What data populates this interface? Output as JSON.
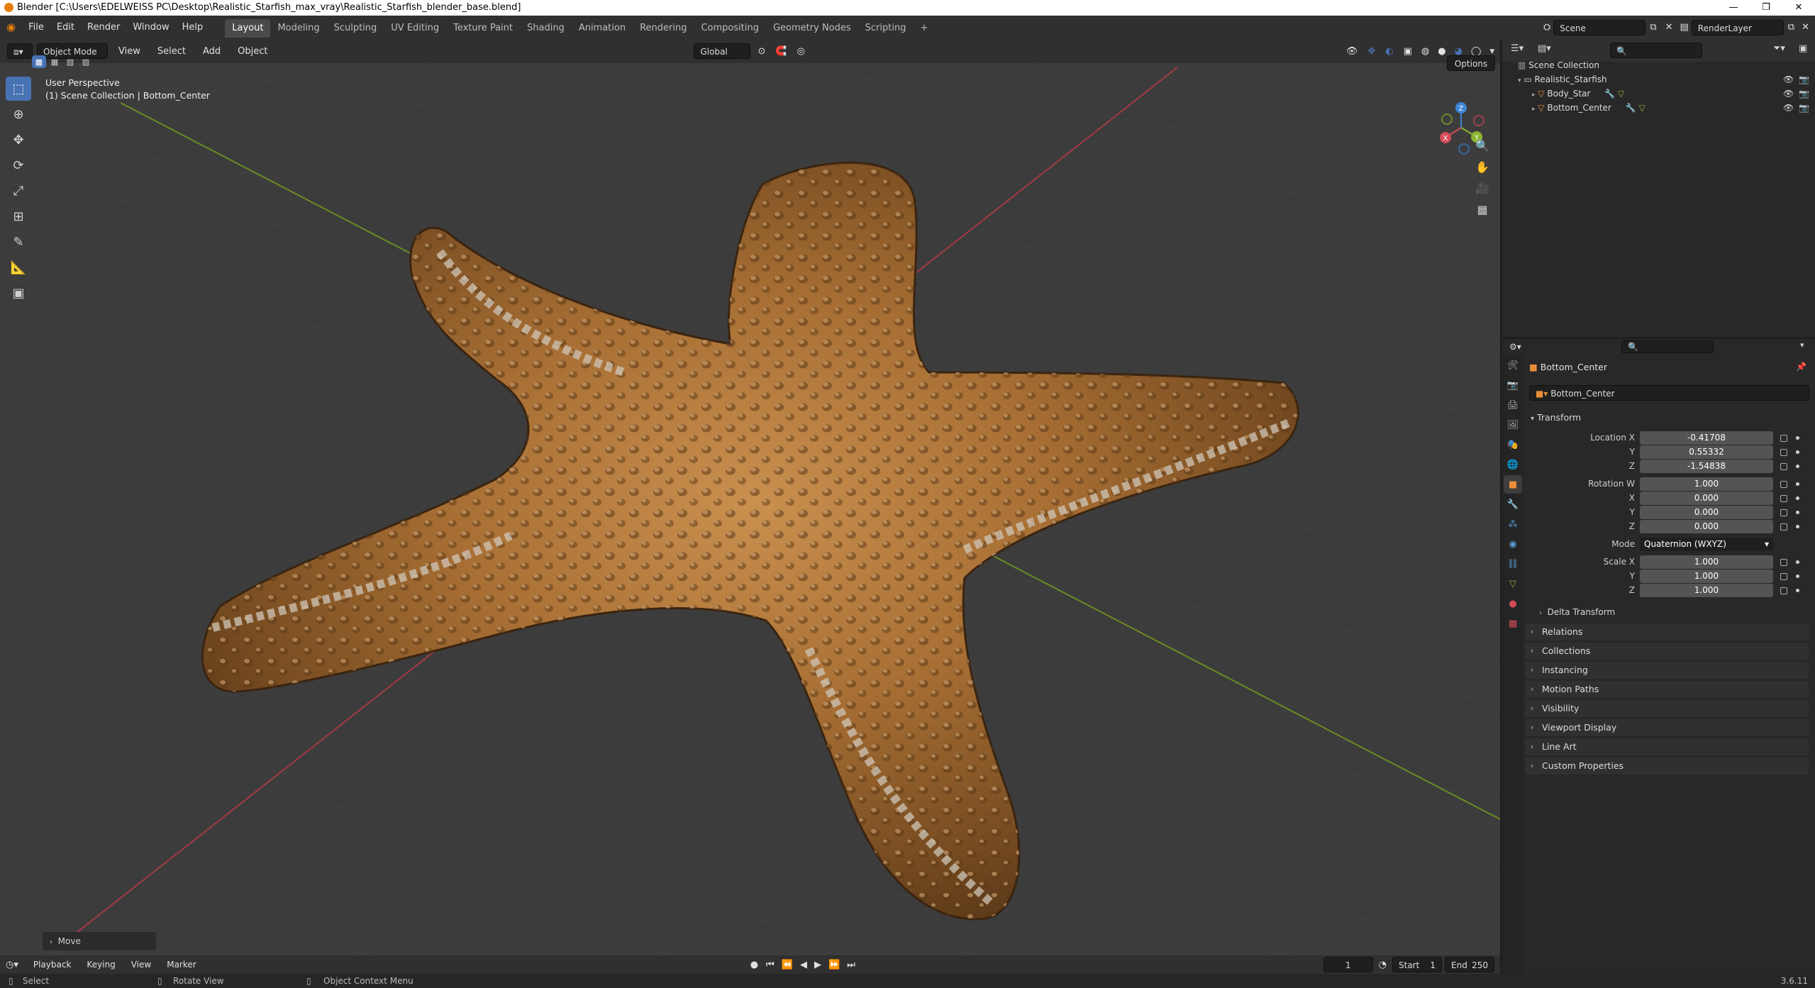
{
  "window": {
    "title": "Blender [C:\\Users\\EDELWEISS PC\\Desktop\\Realistic_Starfish_max_vray\\Realistic_Starfish_blender_base.blend]",
    "controls": [
      "—",
      "❐",
      "✕"
    ]
  },
  "menubar": {
    "items": [
      "File",
      "Edit",
      "Render",
      "Window",
      "Help"
    ],
    "workspaces": [
      "Layout",
      "Modeling",
      "Sculpting",
      "UV Editing",
      "Texture Paint",
      "Shading",
      "Animation",
      "Rendering",
      "Compositing",
      "Geometry Nodes",
      "Scripting"
    ],
    "active_workspace": "Layout",
    "add_tab": "+",
    "scene": "Scene",
    "view_layer": "RenderLayer"
  },
  "viewport_header": {
    "mode": "Object Mode",
    "menus": [
      "View",
      "Select",
      "Add",
      "Object"
    ],
    "orientation": "Global",
    "options": "Options"
  },
  "viewport": {
    "perspective": "User Perspective",
    "collection_path": "(1) Scene Collection | Bottom_Center",
    "last_op": "Move",
    "gizmo": {
      "x": "X",
      "y": "Y",
      "z": "Z"
    }
  },
  "outliner": {
    "root": "Scene Collection",
    "items": [
      {
        "label": "Realistic_Starfish",
        "level": 1,
        "icon": "collection-icon"
      },
      {
        "label": "Body_Star",
        "level": 2,
        "icon": "mesh-object-icon"
      },
      {
        "label": "Bottom_Center",
        "level": 2,
        "icon": "mesh-object-icon"
      }
    ]
  },
  "properties": {
    "object_name": "Bottom_Center",
    "data_name": "Bottom_Center",
    "transform_title": "Transform",
    "location_label": "Location X",
    "location": [
      "-0.41708",
      "0.55332",
      "-1.54838"
    ],
    "rotation_label": "Rotation W",
    "rotation": [
      "1.000",
      "0.000",
      "0.000",
      "0.000"
    ],
    "mode_label": "Mode",
    "mode_value": "Quaternion (WXYZ)",
    "scale_label": "Scale X",
    "scale": [
      "1.000",
      "1.000",
      "1.000"
    ],
    "axis_labels": [
      "Y",
      "Z",
      "X",
      "Y",
      "Z",
      "Y",
      "Z"
    ],
    "delta_transform": "Delta Transform",
    "panels": [
      "Relations",
      "Collections",
      "Instancing",
      "Motion Paths",
      "Visibility",
      "Viewport Display",
      "Line Art",
      "Custom Properties"
    ]
  },
  "timeline": {
    "menus": [
      "Playback",
      "Keying",
      "View",
      "Marker"
    ],
    "current_frame": "1",
    "start_label": "Start",
    "start": "1",
    "end_label": "End",
    "end": "250"
  },
  "statusbar": {
    "select": "Select",
    "rotate": "Rotate View",
    "context": "Object Context Menu",
    "version": "3.6.11"
  },
  "colors": {
    "accent": "#4772b3",
    "x_axis": "#d44c5a",
    "y_axis": "#8bb433",
    "z_axis": "#3d86d6",
    "object_orange": "#e88e3a"
  }
}
